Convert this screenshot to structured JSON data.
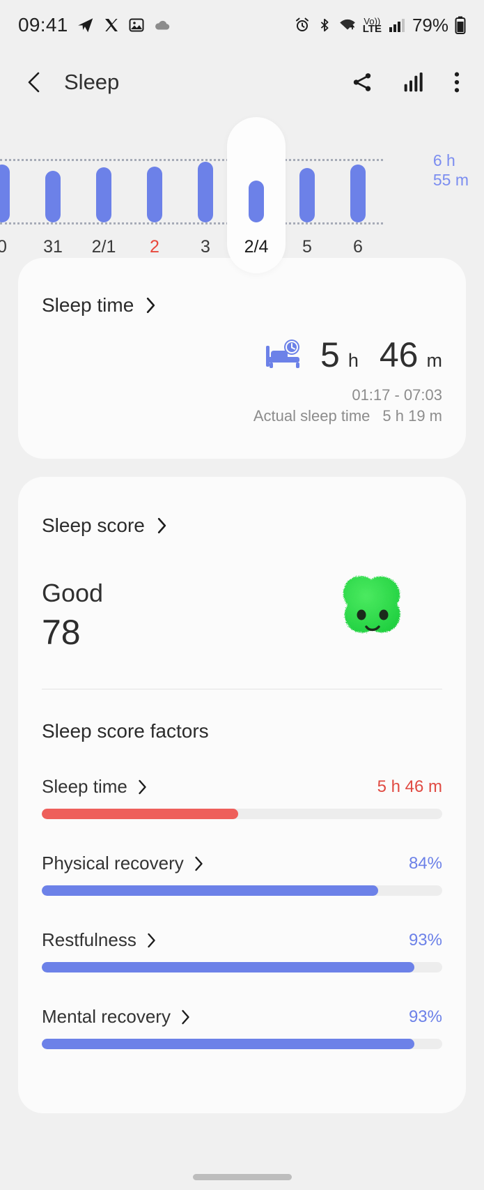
{
  "statusbar": {
    "time": "09:41",
    "battery": "79%",
    "left_icons": [
      "telegram-icon",
      "x-icon",
      "gallery-icon",
      "cloud-icon"
    ],
    "right_icons": [
      "alarm-icon",
      "bluetooth-icon",
      "wifi-icon",
      "volte-icon",
      "signal-icon",
      "battery-icon"
    ],
    "volte_top": "Vo))",
    "volte_bottom": "LTE"
  },
  "appbar": {
    "title": "Sleep",
    "back_icon": "back-chevron-icon",
    "share_icon": "share-icon",
    "stats_icon": "bar-chart-icon",
    "more_icon": "more-vertical-icon"
  },
  "chart_data": {
    "type": "bar",
    "title": "",
    "xlabel": "",
    "ylabel": "",
    "categories": [
      "0",
      "31",
      "2/1",
      "2",
      "3",
      "2/4",
      "5",
      "6"
    ],
    "values": [
      6.3,
      5.6,
      6.0,
      6.1,
      6.6,
      4.6,
      5.9,
      6.3
    ],
    "goal_line_label": "6 h 55 m",
    "goal_label_line1": "6 h",
    "goal_label_line2": "55 m",
    "goal_value": 6.92,
    "ylim": [
      0,
      6.92
    ],
    "selected_index": 5,
    "weekend_index": 3,
    "bar_color": "#6c81e8",
    "grid": true,
    "legend": "none"
  },
  "sleep_time_card": {
    "header": "Sleep time",
    "icon": "bed-clock-icon",
    "hours": "5",
    "hours_unit": "h",
    "minutes": "46",
    "minutes_unit": "m",
    "range": "01:17 - 07:03",
    "actual_label": "Actual sleep time",
    "actual_value": "5 h 19 m"
  },
  "sleep_score_card": {
    "header": "Sleep score",
    "rating": "Good",
    "score": "78",
    "character": "green-blob-character",
    "factors_title": "Sleep score factors",
    "factors": [
      {
        "name": "Sleep time",
        "value": "5 h 46 m",
        "percent": 49,
        "color": "#ee5f5b",
        "value_color": "#e04a42"
      },
      {
        "name": "Physical recovery",
        "value": "84%",
        "percent": 84,
        "color": "#6c81e8",
        "value_color": "#6c81e8"
      },
      {
        "name": "Restfulness",
        "value": "93%",
        "percent": 93,
        "color": "#6c81e8",
        "value_color": "#6c81e8"
      },
      {
        "name": "Mental recovery",
        "value": "93%",
        "percent": 93,
        "color": "#6c81e8",
        "value_color": "#6c81e8"
      }
    ]
  }
}
